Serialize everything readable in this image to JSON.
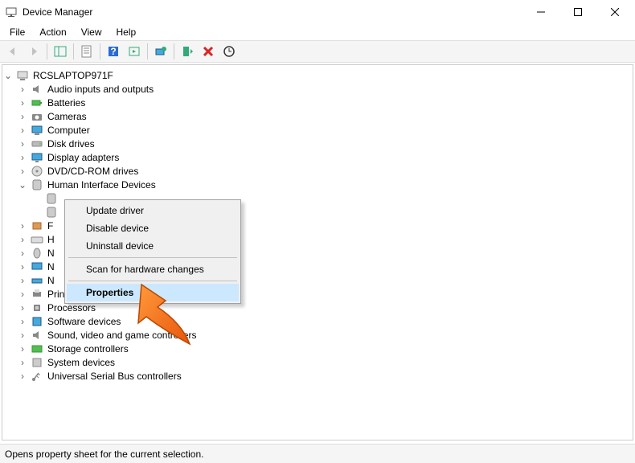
{
  "window": {
    "title": "Device Manager"
  },
  "menu": {
    "file": "File",
    "action": "Action",
    "view": "View",
    "help": "Help"
  },
  "tree": {
    "root": "RCSLAPTOP971F",
    "items": [
      "Audio inputs and outputs",
      "Batteries",
      "Cameras",
      "Computer",
      "Disk drives",
      "Display adapters",
      "DVD/CD-ROM drives",
      "Human Interface Devices"
    ],
    "hid_children": [
      "",
      "",
      "",
      ""
    ],
    "after": [
      "F",
      "H",
      "N",
      "N",
      "N",
      "Print queues",
      "Processors",
      "Software devices",
      "Sound, video and game controllers",
      "Storage controllers",
      "System devices",
      "Universal Serial Bus controllers"
    ]
  },
  "context_menu": {
    "items": [
      "Update driver",
      "Disable device",
      "Uninstall device",
      "Scan for hardware changes",
      "Properties"
    ]
  },
  "status": {
    "text": "Opens property sheet for the current selection."
  }
}
